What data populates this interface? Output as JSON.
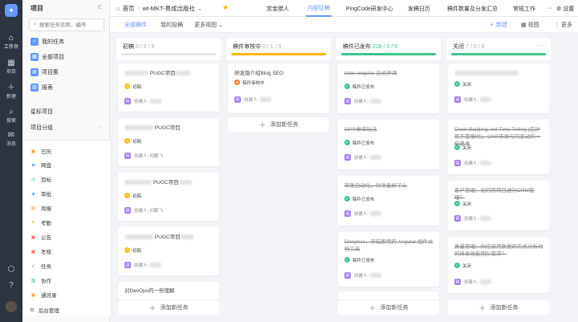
{
  "rail": {
    "items": [
      {
        "label": "工作台",
        "icon": "home-icon"
      },
      {
        "label": "项目",
        "icon": "project-icon"
      },
      {
        "label": "新建",
        "icon": "plus-icon"
      },
      {
        "label": "搜索",
        "icon": "search-icon"
      },
      {
        "label": "消息",
        "icon": "message-icon"
      }
    ]
  },
  "sidebar": {
    "title": "项目",
    "search_placeholder": "搜索任务名称、编号",
    "nav": [
      {
        "label": "我的任务"
      },
      {
        "label": "全部项目"
      },
      {
        "label": "项目集"
      },
      {
        "label": "报表"
      }
    ],
    "starred": "星标项目",
    "groups": "项目分组",
    "apps": [
      {
        "label": "日历",
        "color": "#f6a34a"
      },
      {
        "label": "网盘",
        "color": "#4a90f6"
      },
      {
        "label": "目标",
        "color": "#3cc58f"
      },
      {
        "label": "审批",
        "color": "#4a90f6"
      },
      {
        "label": "简报",
        "color": "#f6a34a"
      },
      {
        "label": "考勤",
        "color": "#f6c34a"
      },
      {
        "label": "公告",
        "color": "#f56a6a"
      },
      {
        "label": "考核",
        "color": "#f56a6a"
      },
      {
        "label": "任务",
        "color": "#4a90f6"
      },
      {
        "label": "协作",
        "color": "#3cc58f"
      },
      {
        "label": "通讯录",
        "color": "#f6a34a"
      }
    ],
    "admin": "后台管理"
  },
  "topbar": {
    "home": "首页",
    "project": "wt-MKT-易成出版社",
    "tabs": [
      {
        "label": "赏金猎人",
        "active": false
      },
      {
        "label": "内部征稿",
        "active": true
      },
      {
        "label": "PingCode研发中心",
        "active": false
      },
      {
        "label": "发稿日历",
        "active": false
      },
      {
        "label": "稿件数量及分发汇总",
        "active": false
      },
      {
        "label": "常规工作",
        "active": false
      }
    ],
    "settings": "设置"
  },
  "subbar": {
    "tabs": [
      {
        "label": "全部稿件",
        "active": true
      },
      {
        "label": "我的投稿",
        "active": false
      },
      {
        "label": "更多视图",
        "active": false
      }
    ],
    "new": "新建",
    "view": "视图",
    "more": "更多"
  },
  "add_task": "添加新任务",
  "columns": [
    {
      "title": "初稿",
      "count": "0 / 0 / 9",
      "color": "#e8e8e8",
      "cards": [
        {
          "title": "PUGC项目",
          "status": "初稿",
          "status_color": "#f5b800",
          "creator": "创建人:"
        },
        {
          "title": "PUGC项目",
          "status": "初稿",
          "status_color": "#f5b800",
          "creator": "创建人: 何鹏飞"
        },
        {
          "title": "PUGC项目",
          "status": "初稿",
          "status_color": "#f5b800",
          "creator": "创建人: 何鹏飞"
        },
        {
          "title": "PUGC项目",
          "status": "初稿",
          "status_color": "#f5b800",
          "creator": "创建人:"
        },
        {
          "title": "对DevOps的一些理解",
          "status": "",
          "status_color": "",
          "creator": ""
        }
      ]
    },
    {
      "title": "稿件审核中",
      "count": "0 / 1 / 0",
      "color": "#f5b800",
      "cards": [
        {
          "title": "研发版介绍Blog SEO",
          "status": "稿件审核中",
          "status_color": "#f5812a",
          "creator": "创建人:"
        }
      ]
    },
    {
      "title": "稿件已发布",
      "count": "228 / 0 / 0",
      "color": "#3cc58f",
      "cards": [
        {
          "title": "slate-angular 正式开源",
          "status": "稿件已发布",
          "status_color": "#3cc58f",
          "creator": "创建人:"
        },
        {
          "title": "5S中举单玩法",
          "status": "稿件已发布",
          "status_color": "#3cc58f",
          "creator": "创建人:"
        },
        {
          "title": "研发自动化，你准备好了么",
          "status": "稿件已发布",
          "status_color": "#3cc58f",
          "creator": "创建人:"
        },
        {
          "title": "Dooglers，开箱即用的 Angular 组件文档工具",
          "status": "稿件已发布",
          "status_color": "#3cc58f",
          "creator": "创建人:"
        },
        {
          "title": "",
          "status": "",
          "status_color": "",
          "creator": ""
        }
      ]
    },
    {
      "title": "关闭",
      "count": "7 / 0 / 0",
      "color": "#3cc58f",
      "cards": [
        {
          "title": "",
          "status": "关闭",
          "status_color": "#3cc58f",
          "creator": "创建人:"
        },
        {
          "title": "Clock Building, not Time Telling (造钟而不是报时)，OKR市场与内驱动的一些思考",
          "status": "关闭",
          "status_color": "#3cc58f",
          "creator": "创建人:"
        },
        {
          "title": "客户管理：如何用项目进行CRM管理？",
          "status": "关闭",
          "status_color": "#3cc58f",
          "creator": "创建人:"
        },
        {
          "title": "质量管理：你应该用数据的方式分析你的研发效能团队需求？",
          "status": "关闭",
          "status_color": "#3cc58f",
          "creator": "创建人:"
        }
      ]
    }
  ]
}
